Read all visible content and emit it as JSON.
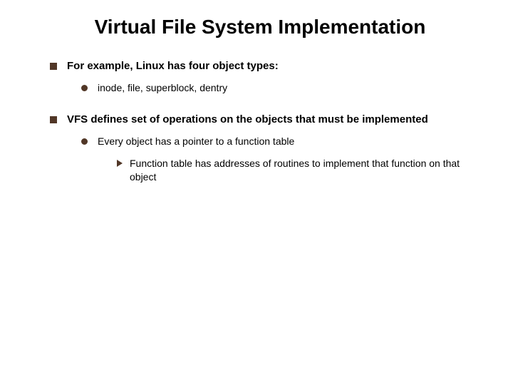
{
  "title": "Virtual File System Implementation",
  "bullets": {
    "b1": "For example, Linux has four object types:",
    "b1_1": "inode, file, superblock, dentry",
    "b2": "VFS defines set of operations on the objects that must be implemented",
    "b2_1": "Every object has a pointer to a function table",
    "b2_1_1": "Function table has addresses of routines to implement that function on that object"
  }
}
